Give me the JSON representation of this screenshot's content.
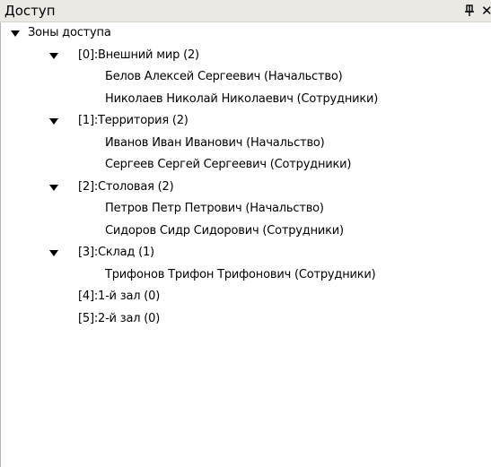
{
  "panel": {
    "title": "Доступ",
    "pin_glyph": "⊥",
    "close_glyph": "✕"
  },
  "tree": {
    "root": {
      "label": "Зоны доступа",
      "expanded": true,
      "zones": [
        {
          "label": "[0]:Внешний мир (2)",
          "expanded": true,
          "people": [
            "Белов Алексей Сергеевич (Начальство)",
            "Николаев Николай Николаевич (Сотрудники)"
          ]
        },
        {
          "label": "[1]:Территория (2)",
          "expanded": true,
          "people": [
            "Иванов Иван Иванович (Начальство)",
            "Сергеев Сергей Сергеевич (Сотрудники)"
          ]
        },
        {
          "label": "[2]:Столовая (2)",
          "expanded": true,
          "people": [
            "Петров Петр Петрович (Начальство)",
            "Сидоров Сидр Сидорович (Сотрудники)"
          ]
        },
        {
          "label": "[3]:Склад (1)",
          "expanded": true,
          "people": [
            "Трифонов Трифон Трифонович (Сотрудники)"
          ]
        },
        {
          "label": "[4]:1-й зал (0)",
          "expanded": false,
          "people": []
        },
        {
          "label": "[5]:2-й зал (0)",
          "expanded": false,
          "people": []
        }
      ]
    }
  }
}
